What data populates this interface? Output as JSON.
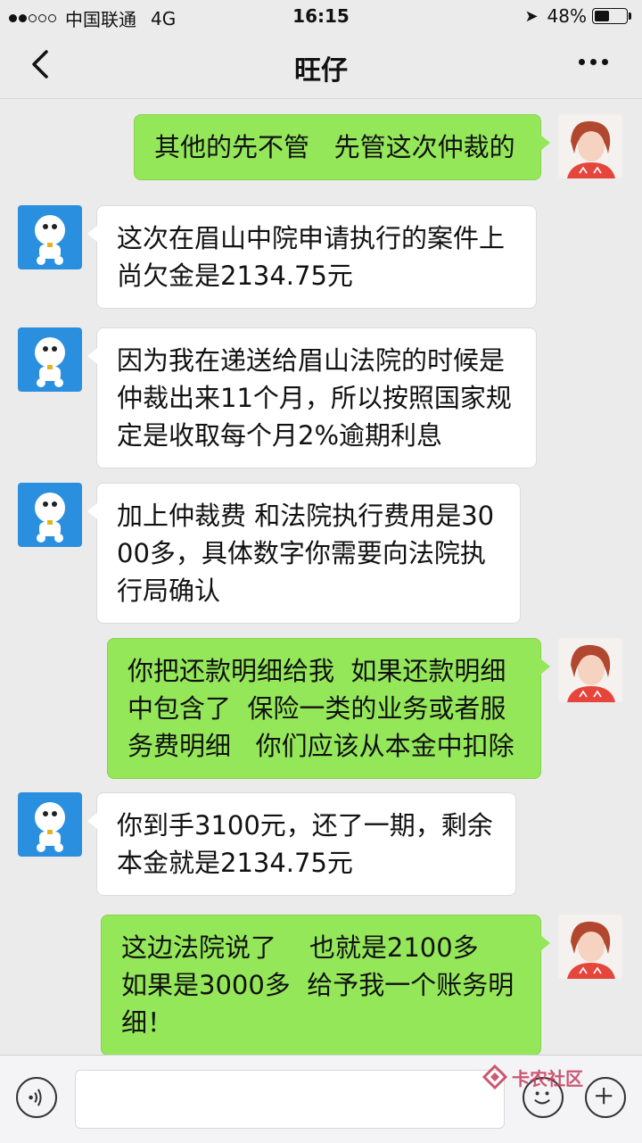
{
  "status_bar": {
    "carrier": "中国联通",
    "network": "4G",
    "time": "16:15",
    "battery": "48%",
    "battery_level": 0.48
  },
  "nav": {
    "title": "旺仔"
  },
  "messages": [
    {
      "side": "right",
      "text": "其他的先不管   先管这次仲裁的"
    },
    {
      "side": "left",
      "text": "这次在眉山中院申请执行的案件上尚欠金是2134.75元"
    },
    {
      "side": "left",
      "text": "因为我在递送给眉山法院的时候是仲裁出来11个月，所以按照国家规定是收取每个月2%逾期利息"
    },
    {
      "side": "left",
      "text": "加上仲裁费 和法院执行费用是3000多，具体数字你需要向法院执行局确认"
    },
    {
      "side": "right",
      "text": "你把还款明细给我  如果还款明细中包含了  保险一类的业务或者服务费明细   你们应该从本金中扣除"
    },
    {
      "side": "left",
      "text": "你到手3100元，还了一期，剩余本金就是2134.75元"
    },
    {
      "side": "right",
      "text": "这边法院说了    也就是2100多    如果是3000多  给予我一个账务明细！"
    }
  ],
  "watermark": {
    "text": "卡农社区"
  },
  "colors": {
    "background": "#ebebeb",
    "bubble_sent": "#95e75a",
    "bubble_received": "#ffffff",
    "watermark": "#c43b5b"
  }
}
